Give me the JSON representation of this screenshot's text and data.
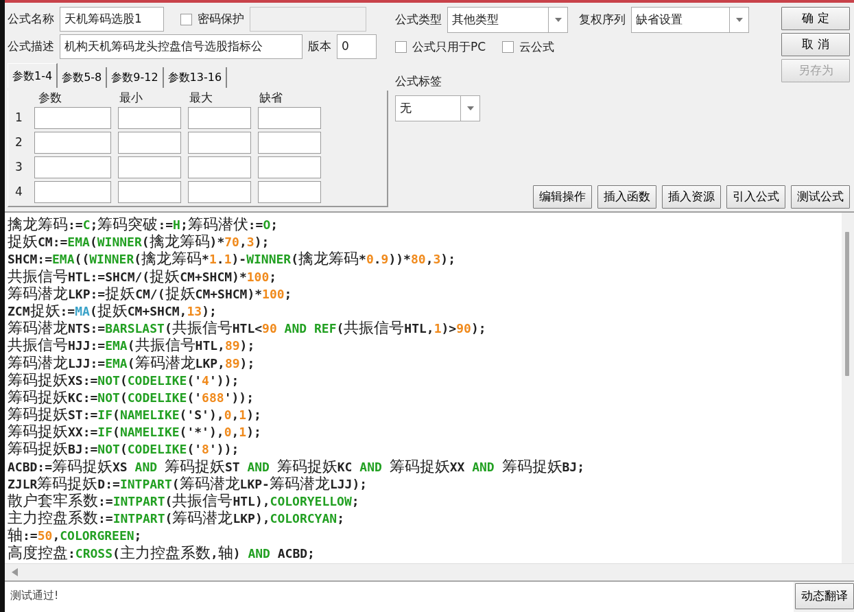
{
  "form": {
    "name_label": "公式名称",
    "name_value": "天机筹码选股1",
    "password": {
      "label": "密码保护",
      "checked": false
    },
    "desc_label": "公式描述",
    "desc_value": "机构天机筹码龙头控盘信号选股指标公",
    "version_label": "版本",
    "version_value": "0"
  },
  "param_tabs": [
    {
      "label": "参数1-4",
      "selected": true
    },
    {
      "label": "参数5-8",
      "selected": false
    },
    {
      "label": "参数9-12",
      "selected": false
    },
    {
      "label": "参数13-16",
      "selected": false
    }
  ],
  "param_table": {
    "columns": [
      "参数",
      "最小",
      "最大",
      "缺省"
    ],
    "rows": [
      "1",
      "2",
      "3",
      "4"
    ]
  },
  "formula_type": {
    "label": "公式类型",
    "value": "其他类型"
  },
  "adjust_series": {
    "label": "复权序列",
    "value": "缺省设置"
  },
  "options": [
    {
      "label": "公式只用于PC",
      "checked": false
    },
    {
      "label": "云公式",
      "checked": false
    }
  ],
  "formula_tag": {
    "label": "公式标签",
    "value": "无"
  },
  "side_buttons": [
    {
      "label": "确 定",
      "disabled": false
    },
    {
      "label": "取 消",
      "disabled": false
    },
    {
      "label": "另存为",
      "disabled": true
    }
  ],
  "tool_buttons": [
    "编辑操作",
    "插入函数",
    "插入资源",
    "引入公式",
    "测试公式"
  ],
  "code_lines": [
    [
      {
        "kind": "text",
        "text": "擒龙筹码:="
      },
      {
        "kind": "func",
        "text": "C"
      },
      {
        "kind": "text",
        "text": ";筹码突破:="
      },
      {
        "kind": "func",
        "text": "H"
      },
      {
        "kind": "text",
        "text": ";筹码潜伏:="
      },
      {
        "kind": "func",
        "text": "O"
      },
      {
        "kind": "text",
        "text": ";"
      }
    ],
    [
      {
        "kind": "text",
        "text": "捉妖CM:="
      },
      {
        "kind": "func",
        "text": "EMA"
      },
      {
        "kind": "text",
        "text": "("
      },
      {
        "kind": "func",
        "text": "WINNER"
      },
      {
        "kind": "text",
        "text": "(擒龙筹码)*"
      },
      {
        "kind": "num",
        "text": "70"
      },
      {
        "kind": "text",
        "text": ","
      },
      {
        "kind": "num",
        "text": "3"
      },
      {
        "kind": "text",
        "text": ");"
      }
    ],
    [
      {
        "kind": "text",
        "text": "SHCM:="
      },
      {
        "kind": "func",
        "text": "EMA"
      },
      {
        "kind": "text",
        "text": "(("
      },
      {
        "kind": "func",
        "text": "WINNER"
      },
      {
        "kind": "text",
        "text": "(擒龙筹码*"
      },
      {
        "kind": "num",
        "text": "1"
      },
      {
        "kind": "text",
        "text": "."
      },
      {
        "kind": "num",
        "text": "1"
      },
      {
        "kind": "text",
        "text": ")-"
      },
      {
        "kind": "func",
        "text": "WINNER"
      },
      {
        "kind": "text",
        "text": "(擒龙筹码*"
      },
      {
        "kind": "num",
        "text": "0"
      },
      {
        "kind": "text",
        "text": "."
      },
      {
        "kind": "num",
        "text": "9"
      },
      {
        "kind": "text",
        "text": "))*"
      },
      {
        "kind": "num",
        "text": "80"
      },
      {
        "kind": "text",
        "text": ","
      },
      {
        "kind": "num",
        "text": "3"
      },
      {
        "kind": "text",
        "text": ");"
      }
    ],
    [
      {
        "kind": "text",
        "text": "共振信号HTL:=SHCM/(捉妖CM+SHCM)*"
      },
      {
        "kind": "num",
        "text": "100"
      },
      {
        "kind": "text",
        "text": ";"
      }
    ],
    [
      {
        "kind": "text",
        "text": "筹码潜龙LKP:=捉妖CM/(捉妖CM+SHCM)*"
      },
      {
        "kind": "num",
        "text": "100"
      },
      {
        "kind": "text",
        "text": ";"
      }
    ],
    [
      {
        "kind": "text",
        "text": "ZCM捉妖:="
      },
      {
        "kind": "func_alt",
        "text": "MA"
      },
      {
        "kind": "text",
        "text": "(捉妖CM+SHCM,"
      },
      {
        "kind": "num",
        "text": "13"
      },
      {
        "kind": "text",
        "text": ");"
      }
    ],
    [
      {
        "kind": "text",
        "text": "筹码潜龙NTS:="
      },
      {
        "kind": "func",
        "text": "BARSLAST"
      },
      {
        "kind": "text",
        "text": "(共振信号HTL<"
      },
      {
        "kind": "num",
        "text": "90"
      },
      {
        "kind": "func",
        "text": " AND "
      },
      {
        "kind": "func",
        "text": "REF"
      },
      {
        "kind": "text",
        "text": "(共振信号HTL,"
      },
      {
        "kind": "num",
        "text": "1"
      },
      {
        "kind": "text",
        "text": ")>"
      },
      {
        "kind": "num",
        "text": "90"
      },
      {
        "kind": "text",
        "text": ");"
      }
    ],
    [
      {
        "kind": "text",
        "text": "共振信号HJJ:="
      },
      {
        "kind": "func",
        "text": "EMA"
      },
      {
        "kind": "text",
        "text": "(共振信号HTL,"
      },
      {
        "kind": "num",
        "text": "89"
      },
      {
        "kind": "text",
        "text": ");"
      }
    ],
    [
      {
        "kind": "text",
        "text": "筹码潜龙LJJ:="
      },
      {
        "kind": "func",
        "text": "EMA"
      },
      {
        "kind": "text",
        "text": "(筹码潜龙LKP,"
      },
      {
        "kind": "num",
        "text": "89"
      },
      {
        "kind": "text",
        "text": ");"
      }
    ],
    [
      {
        "kind": "text",
        "text": "筹码捉妖XS:="
      },
      {
        "kind": "func",
        "text": "NOT"
      },
      {
        "kind": "text",
        "text": "("
      },
      {
        "kind": "func",
        "text": "CODELIKE"
      },
      {
        "kind": "text",
        "text": "('"
      },
      {
        "kind": "num",
        "text": "4"
      },
      {
        "kind": "text",
        "text": "'));"
      }
    ],
    [
      {
        "kind": "text",
        "text": "筹码捉妖KC:="
      },
      {
        "kind": "func",
        "text": "NOT"
      },
      {
        "kind": "text",
        "text": "("
      },
      {
        "kind": "func",
        "text": "CODELIKE"
      },
      {
        "kind": "text",
        "text": "('"
      },
      {
        "kind": "num",
        "text": "688"
      },
      {
        "kind": "text",
        "text": "'));"
      }
    ],
    [
      {
        "kind": "text",
        "text": "筹码捉妖ST:="
      },
      {
        "kind": "func",
        "text": "IF"
      },
      {
        "kind": "text",
        "text": "("
      },
      {
        "kind": "func",
        "text": "NAMELIKE"
      },
      {
        "kind": "text",
        "text": "('S'),"
      },
      {
        "kind": "num",
        "text": "0"
      },
      {
        "kind": "text",
        "text": ","
      },
      {
        "kind": "num",
        "text": "1"
      },
      {
        "kind": "text",
        "text": ");"
      }
    ],
    [
      {
        "kind": "text",
        "text": "筹码捉妖XX:="
      },
      {
        "kind": "func",
        "text": "IF"
      },
      {
        "kind": "text",
        "text": "("
      },
      {
        "kind": "func",
        "text": "NAMELIKE"
      },
      {
        "kind": "text",
        "text": "('*'),"
      },
      {
        "kind": "num",
        "text": "0"
      },
      {
        "kind": "text",
        "text": ","
      },
      {
        "kind": "num",
        "text": "1"
      },
      {
        "kind": "text",
        "text": ");"
      }
    ],
    [
      {
        "kind": "text",
        "text": "筹码捉妖BJ:="
      },
      {
        "kind": "func",
        "text": "NOT"
      },
      {
        "kind": "text",
        "text": "("
      },
      {
        "kind": "func",
        "text": "CODELIKE"
      },
      {
        "kind": "text",
        "text": "('"
      },
      {
        "kind": "num",
        "text": "8"
      },
      {
        "kind": "text",
        "text": "'));"
      }
    ],
    [
      {
        "kind": "text",
        "text": "ACBD:=筹码捉妖XS "
      },
      {
        "kind": "func",
        "text": "AND"
      },
      {
        "kind": "text",
        "text": " 筹码捉妖ST "
      },
      {
        "kind": "func",
        "text": "AND"
      },
      {
        "kind": "text",
        "text": " 筹码捉妖KC "
      },
      {
        "kind": "func",
        "text": "AND"
      },
      {
        "kind": "text",
        "text": " 筹码捉妖XX "
      },
      {
        "kind": "func",
        "text": "AND"
      },
      {
        "kind": "text",
        "text": " 筹码捉妖BJ;"
      }
    ],
    [
      {
        "kind": "text",
        "text": "ZJLR筹码捉妖D:="
      },
      {
        "kind": "func",
        "text": "INTPART"
      },
      {
        "kind": "text",
        "text": "(筹码潜龙LKP-筹码潜龙LJJ);"
      }
    ],
    [
      {
        "kind": "text",
        "text": "散户套牢系数:="
      },
      {
        "kind": "func",
        "text": "INTPART"
      },
      {
        "kind": "text",
        "text": "(共振信号HTL),"
      },
      {
        "kind": "func",
        "text": "COLORYELLOW"
      },
      {
        "kind": "text",
        "text": ";"
      }
    ],
    [
      {
        "kind": "text",
        "text": "主力控盘系数:="
      },
      {
        "kind": "func",
        "text": "INTPART"
      },
      {
        "kind": "text",
        "text": "(筹码潜龙LKP),"
      },
      {
        "kind": "func",
        "text": "COLORCYAN"
      },
      {
        "kind": "text",
        "text": ";"
      }
    ],
    [
      {
        "kind": "text",
        "text": "轴:="
      },
      {
        "kind": "num",
        "text": "50"
      },
      {
        "kind": "text",
        "text": ","
      },
      {
        "kind": "func",
        "text": "COLORGREEN"
      },
      {
        "kind": "text",
        "text": ";"
      }
    ],
    [
      {
        "kind": "text",
        "text": "高度控盘:"
      },
      {
        "kind": "func",
        "text": "CROSS"
      },
      {
        "kind": "text",
        "text": "(主力控盘系数,轴) "
      },
      {
        "kind": "func",
        "text": "AND"
      },
      {
        "kind": "text",
        "text": " ACBD;"
      }
    ]
  ],
  "status": "测试通过!",
  "translate_button": "动态翻译"
}
